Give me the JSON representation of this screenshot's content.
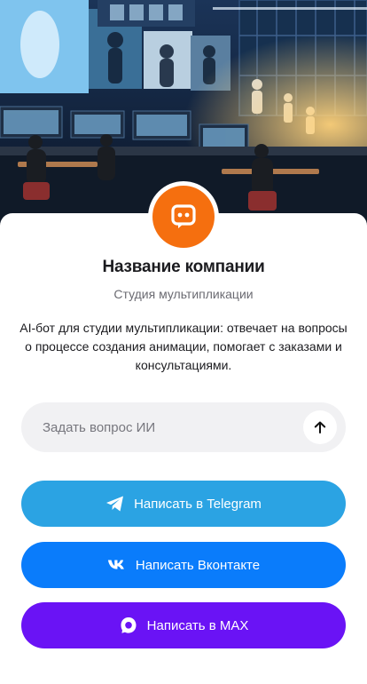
{
  "hero": {
    "alt_icon": "animation-studio-illustration"
  },
  "company": {
    "name": "Название компании",
    "category": "Студия мультипликации",
    "description": "AI-бот для студии мультипликации: отвечает на вопросы о процессе создания анимации, помогает с заказами и консультациями.",
    "avatar_icon": "chat-bot-icon",
    "avatar_color": "#f56f0f"
  },
  "ask": {
    "placeholder": "Задать вопрос ИИ",
    "value": "",
    "send_icon": "arrow-up-icon"
  },
  "buttons": {
    "telegram": {
      "label": "Написать в Telegram",
      "icon": "telegram-icon",
      "color": "#2ba3e3"
    },
    "vk": {
      "label": "Написать Вконтакте",
      "icon": "vk-icon",
      "color": "#0a7cfb"
    },
    "max": {
      "label": "Написать в MAX",
      "icon": "max-icon",
      "color": "#6a13f5"
    }
  }
}
